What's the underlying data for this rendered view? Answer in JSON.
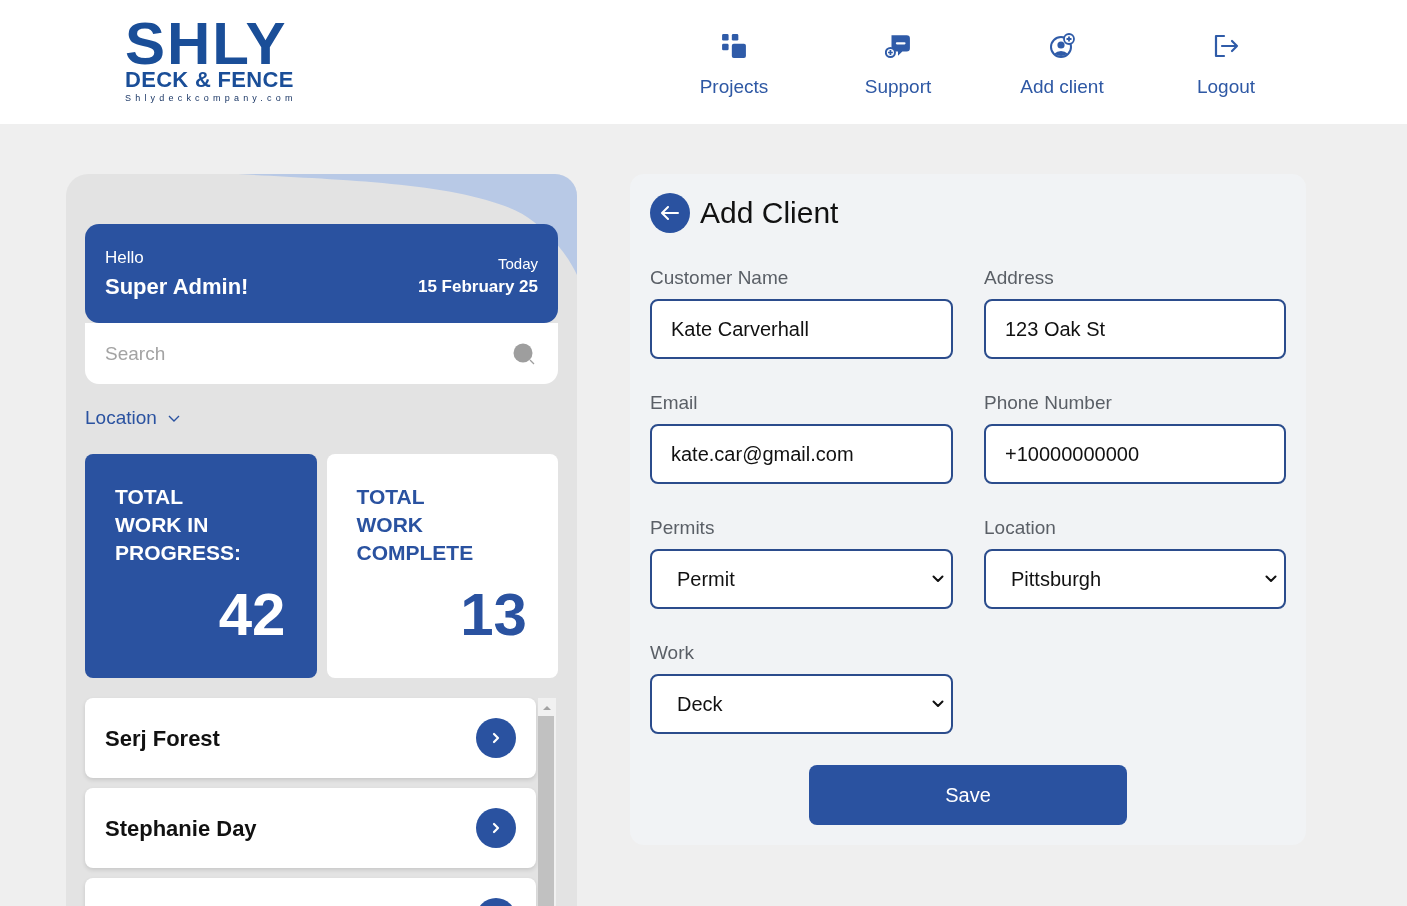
{
  "header": {
    "logo": {
      "wordmark": "SHLY",
      "tagline": "DECK & FENCE",
      "website": "Shlydeckcompany.com"
    },
    "nav": [
      {
        "kind": "projects",
        "label": "Projects"
      },
      {
        "kind": "support",
        "label": "Support"
      },
      {
        "kind": "add_client",
        "label": "Add client"
      },
      {
        "kind": "logout",
        "label": "Logout"
      }
    ]
  },
  "sidebar": {
    "greeting": {
      "hello": "Hello",
      "user": "Super Admin!",
      "date_label": "Today",
      "date": "15 February 25"
    },
    "search": {
      "placeholder": "Search"
    },
    "location_filter": {
      "label": "Location"
    },
    "stats": [
      {
        "kind": "primary",
        "label": "TOTAL WORK IN PROGRESS:",
        "value": "42"
      },
      {
        "kind": "secondary",
        "label": "TOTAL WORK COMPLETE",
        "value": "13"
      }
    ],
    "clients": [
      {
        "kind": "client",
        "name": "Serj Forest"
      },
      {
        "kind": "client",
        "name": "Stephanie Day"
      },
      {
        "kind": "client"
      }
    ]
  },
  "form": {
    "title": "Add Client",
    "fields": [
      {
        "kind": "text",
        "label": "Customer Name",
        "value": "Kate Carverhall"
      },
      {
        "kind": "text",
        "label": "Address",
        "value": "123 Oak St"
      },
      {
        "kind": "text",
        "label": "Email",
        "value": "kate.car@gmail.com"
      },
      {
        "kind": "text",
        "label": "Phone Number",
        "value": "+10000000000"
      },
      {
        "kind": "select",
        "label": "Permits",
        "value": "Permit"
      },
      {
        "kind": "select",
        "label": "Location",
        "value": "Pittsburgh"
      },
      {
        "kind": "select",
        "label": "Work",
        "value": "Deck"
      }
    ],
    "submit": "Save"
  }
}
